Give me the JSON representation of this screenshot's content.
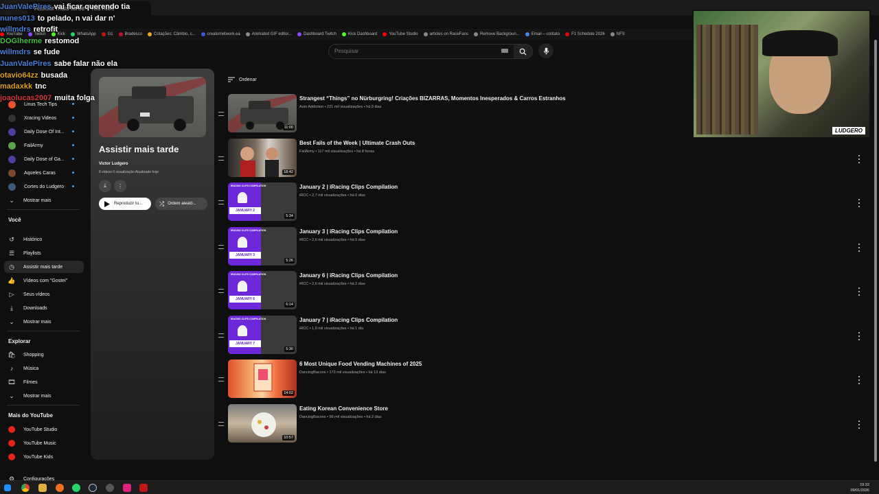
{
  "browser": {
    "tab_title": "Assistir mais tarde - YouTube",
    "bookmarks": [
      {
        "label": "YouTube",
        "color": "#ff0000"
      },
      {
        "label": "Twitch",
        "color": "#9146ff"
      },
      {
        "label": "Kick",
        "color": "#53fc18"
      },
      {
        "label": "WhatsApp",
        "color": "#25d366"
      },
      {
        "label": "G1",
        "color": "#c4170c"
      },
      {
        "label": "Bradesco",
        "color": "#cc092f"
      },
      {
        "label": "Cotações: Câmbio, c...",
        "color": "#f5a623"
      },
      {
        "label": "creatornetwork.ea",
        "color": "#3b5bdb"
      },
      {
        "label": "Animated GIF editor...",
        "color": "#888888"
      },
      {
        "label": "Dashboard Twitch",
        "color": "#9146ff"
      },
      {
        "label": "Kick Dashboard",
        "color": "#53fc18"
      },
      {
        "label": "YouTube Studio",
        "color": "#ff0000"
      },
      {
        "label": "articles on RaceFans",
        "color": "#888888"
      },
      {
        "label": "Remove Backgroun...",
        "color": "#888888"
      },
      {
        "label": "Email – contato",
        "color": "#4285f4"
      },
      {
        "label": "F1 Schedule 2026",
        "color": "#e10600"
      },
      {
        "label": "NFS",
        "color": "#888888"
      }
    ]
  },
  "header": {
    "search_placeholder": "Pesquisar"
  },
  "sidebar": {
    "subscriptions": [
      {
        "label": "Linus Tech Tips",
        "color": "#e8522a"
      },
      {
        "label": "Xracing Videos",
        "color": "#333333"
      },
      {
        "label": "Daily Dose Of Int...",
        "color": "#4a3fa0"
      },
      {
        "label": "FailArmy",
        "color": "#5aa34a"
      },
      {
        "label": "Daily Dose of Ga...",
        "color": "#4a3fa0"
      },
      {
        "label": "Aqueles Caras",
        "color": "#7a4a2a"
      },
      {
        "label": "Cortes do Ludgero",
        "color": "#3a5a7a"
      }
    ],
    "show_more": "Mostrar mais",
    "voce_title": "Você",
    "voce_items": [
      {
        "label": "Histórico",
        "icon": "history-icon",
        "glyph": "↺"
      },
      {
        "label": "Playlists",
        "icon": "playlists-icon",
        "glyph": "☰"
      },
      {
        "label": "Assistir mais tarde",
        "icon": "clock-icon",
        "glyph": "◷"
      },
      {
        "label": "Vídeos com \"Gostei\"",
        "icon": "thumbs-up-icon",
        "glyph": "👍"
      },
      {
        "label": "Seus vídeos",
        "icon": "your-videos-icon",
        "glyph": "▷"
      },
      {
        "label": "Downloads",
        "icon": "download-icon",
        "glyph": "⤓"
      },
      {
        "label": "Mostrar mais",
        "icon": "chevron-down-icon",
        "glyph": "⌄"
      }
    ],
    "explore_title": "Explorar",
    "explore_items": [
      {
        "label": "Shopping",
        "icon": "shopping-icon",
        "glyph": "🛍"
      },
      {
        "label": "Música",
        "icon": "music-icon",
        "glyph": "♪"
      },
      {
        "label": "Filmes",
        "icon": "film-icon",
        "glyph": "🎞"
      },
      {
        "label": "Mostrar mais",
        "icon": "chevron-down-icon",
        "glyph": "⌄"
      }
    ],
    "more_title": "Mais do YouTube",
    "more_items": [
      {
        "label": "YouTube Studio"
      },
      {
        "label": "YouTube Music"
      },
      {
        "label": "YouTube Kids"
      }
    ],
    "settings": "Configurações"
  },
  "playlist": {
    "title": "Assistir mais tarde",
    "owner": "Victor Ludgero",
    "meta": "8 vídeos  0 visualização  Atualizado hoje",
    "play_label": "Reproduzir tu...",
    "shuffle_label": "Ordem aleató...",
    "sort_label": "Ordenar"
  },
  "videos": [
    {
      "title": "Strangest “Things” no Nürburgring! Criações BIZARRAS, Momentos Inesperados & Carros Estranhos",
      "meta": "Auto Addiction • 221 mil visualizações • há 9 dias",
      "duration": "11:00",
      "thumb": "car"
    },
    {
      "title": "Best Fails of the Week | Ultimate Crash Outs",
      "meta": "FailArmy • 117 mil visualizações • há 8 horas",
      "duration": "18:42",
      "thumb": "fails"
    },
    {
      "title": "January 2 | iRacing Clips Compilation",
      "meta": "iRCC • 2,7 mil visualizações • há 6 dias",
      "duration": "5:34",
      "thumb": "iracing",
      "day": "JANUARY 2"
    },
    {
      "title": "January 3 | iRacing Clips Compilation",
      "meta": "iRCC • 2,6 mil visualizações • há 5 dias",
      "duration": "5:26",
      "thumb": "iracing",
      "day": "JANUARY 3"
    },
    {
      "title": "January 6 | iRacing Clips Compilation",
      "meta": "iRCC • 2,6 mil visualizações • há 2 dias",
      "duration": "6:14",
      "thumb": "iracing",
      "day": "JANUARY 6"
    },
    {
      "title": "January 7 | iRacing Clips Compilation",
      "meta": "iRCC • 1,9 mil visualizações • há 1 dia",
      "duration": "5:30",
      "thumb": "iracing",
      "day": "JANUARY 7"
    },
    {
      "title": "6 Most Unique Food Vending Machines of 2025",
      "meta": "DancingBacons • 173 mil visualizações • há 13 dias",
      "duration": "14:02",
      "thumb": "vending"
    },
    {
      "title": "Eating Korean Convenience Store",
      "meta": "DancingBacons • 96 mil visualizações • há 2 dias",
      "duration": "10:57",
      "thumb": "korean"
    }
  ],
  "iracing_thumb_text": "IRACING CLIPS COMPILATION",
  "chat": [
    {
      "user": "JuanValePires",
      "text": "vai ficar querendo tia",
      "color": "#4a7fd8"
    },
    {
      "user": "nunes013",
      "text": "to pelado, n vai dar n'",
      "color": "#4a7fd8"
    },
    {
      "user": "willmdrs",
      "text": "retrofit",
      "color": "#4a7fd8"
    },
    {
      "user": "DOGlherme",
      "text": "restomod",
      "color": "#3fbf3f"
    },
    {
      "user": "willmdrs",
      "text": "se fude",
      "color": "#4a7fd8"
    },
    {
      "user": "JuanValePires",
      "text": "sabe falar não ela",
      "color": "#4a7fd8"
    },
    {
      "user": "otavio64zz",
      "text": "busada",
      "color": "#e0a020"
    },
    {
      "user": "madaxkk",
      "text": "tnc",
      "color": "#e0a020"
    },
    {
      "user": "joaolucas2007",
      "text": "muita folga",
      "color": "#d23a3a"
    }
  ],
  "webcam": {
    "brand": "LUDGERO"
  },
  "taskbar": {
    "time": "19:32",
    "date": "09/01/2026"
  }
}
